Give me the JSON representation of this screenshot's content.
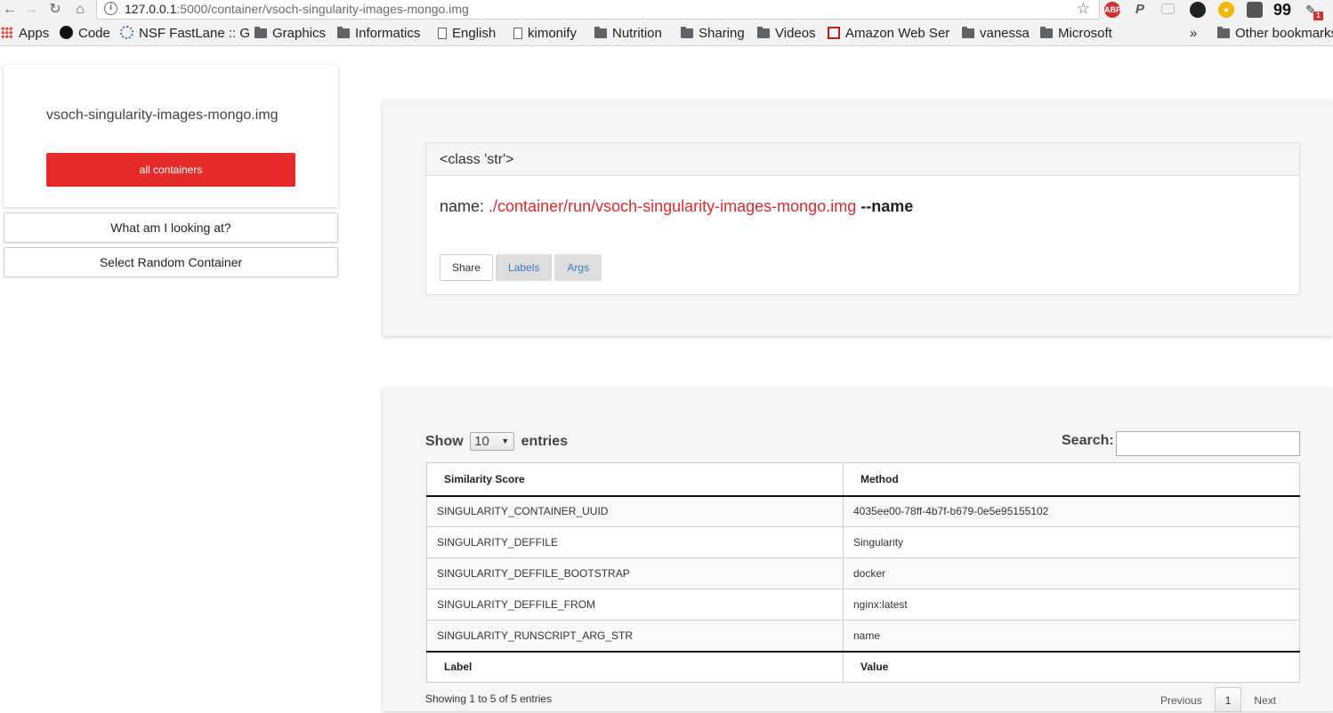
{
  "browser": {
    "url_host": "127.0.0.1",
    "url_path": ":5000/container/vsoch-singularity-images-mongo.img",
    "info_icon": "i",
    "abp_label": "ABP",
    "paypal_label": "P",
    "quote_label": "99",
    "badge_count": "1",
    "bookmarks": [
      {
        "label": "Apps",
        "icon": "apps-grid-icon"
      },
      {
        "label": "Code",
        "icon": "github-icon"
      },
      {
        "label": "NSF FastLane :: G",
        "icon": "nsf-icon"
      },
      {
        "label": "Graphics",
        "icon": "folder-icon"
      },
      {
        "label": "Informatics",
        "icon": "folder-icon"
      },
      {
        "label": "English",
        "icon": "page-icon"
      },
      {
        "label": "kimonify",
        "icon": "page-icon"
      },
      {
        "label": "Nutrition",
        "icon": "folder-icon"
      },
      {
        "label": "Sharing",
        "icon": "folder-icon"
      },
      {
        "label": "Videos",
        "icon": "folder-icon"
      },
      {
        "label": "Amazon Web Ser",
        "icon": "aws-icon"
      },
      {
        "label": "vanessa",
        "icon": "folder-icon"
      },
      {
        "label": "Microsoft",
        "icon": "folder-icon"
      }
    ],
    "overflow_label": "»",
    "other_bookmarks": "Other bookmarks"
  },
  "sidebar": {
    "title": "vsoch-singularity-images-mongo.img",
    "all_containers": "all containers",
    "what_looking": "What am I looking at?",
    "random": "Select Random Container"
  },
  "card": {
    "header": "<class 'str'>",
    "name_prefix": "name: ",
    "name_path": "./container/run/vsoch-singularity-images-mongo.img",
    "name_flag": "--name",
    "buttons": [
      "Share",
      "Labels",
      "Args"
    ]
  },
  "table": {
    "show_label": "Show",
    "show_value": "10",
    "entries_label": "entries",
    "search_label": "Search:",
    "columns": [
      "Similarity Score",
      "Method"
    ],
    "rows": [
      [
        "SINGULARITY_CONTAINER_UUID",
        "4035ee00-78ff-4b7f-b679-0e5e95155102"
      ],
      [
        "SINGULARITY_DEFFILE",
        "Singularity"
      ],
      [
        "SINGULARITY_DEFFILE_BOOTSTRAP",
        "docker"
      ],
      [
        "SINGULARITY_DEFFILE_FROM",
        "nginx:latest"
      ],
      [
        "SINGULARITY_RUNSCRIPT_ARG_STR",
        "name"
      ]
    ],
    "footer_columns": [
      "Label",
      "Value"
    ],
    "info": "Showing 1 to 5 of 5 entries",
    "previous": "Previous",
    "page": "1",
    "next": "Next"
  },
  "colors": {
    "accent_red": "#e52a2a",
    "link_blue": "#3a7bc1"
  }
}
